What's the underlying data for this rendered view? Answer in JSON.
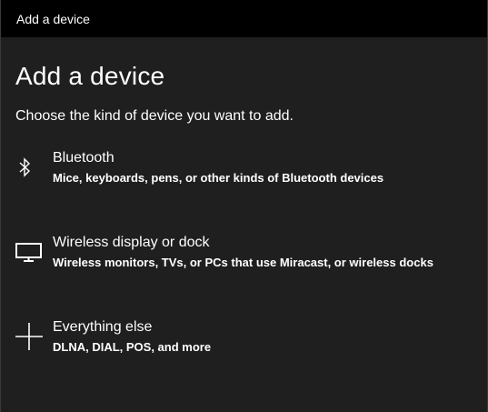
{
  "window": {
    "title": "Add a device"
  },
  "page": {
    "heading": "Add a device",
    "subtitle": "Choose the kind of device you want to add."
  },
  "options": [
    {
      "icon": "bluetooth-icon",
      "title": "Bluetooth",
      "description": "Mice, keyboards, pens, or other kinds of Bluetooth devices"
    },
    {
      "icon": "monitor-icon",
      "title": "Wireless display or dock",
      "description": "Wireless monitors, TVs, or PCs that use Miracast, or wireless docks"
    },
    {
      "icon": "plus-icon",
      "title": "Everything else",
      "description": "DLNA, DIAL, POS, and more"
    }
  ],
  "colors": {
    "titlebar_bg": "#000000",
    "window_bg": "#1f1f1f",
    "text": "#ffffff"
  }
}
